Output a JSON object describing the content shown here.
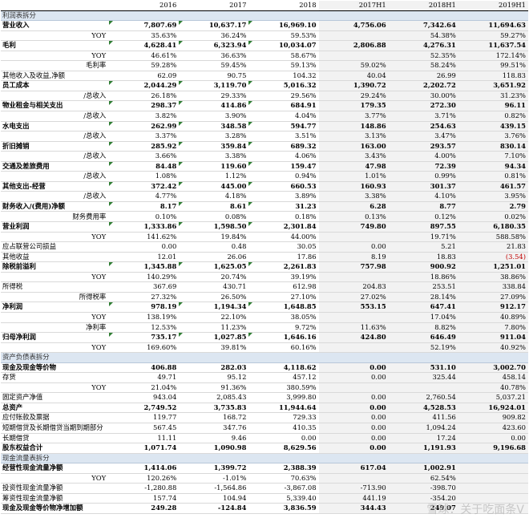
{
  "header": {
    "blank": "",
    "years": [
      "2016",
      "2017",
      "2018",
      "2017H1",
      "2018H1",
      "2019H1"
    ]
  },
  "sections": {
    "income": "利润表拆分",
    "balance": "资产负债表拆分",
    "cashflow": "现金流量表拆分"
  },
  "rows": {
    "r1": {
      "label": "营业收入",
      "v": [
        "7,807.69",
        "10,637.17",
        "16,969.10",
        "4,756.06",
        "7,342.64",
        "11,694.63"
      ]
    },
    "r2": {
      "label": "YOY",
      "v": [
        "35.63%",
        "36.24%",
        "59.53%",
        "",
        "54.38%",
        "59.27%"
      ]
    },
    "r3": {
      "label": "毛利",
      "v": [
        "4,628.41",
        "6,323.94",
        "10,034.07",
        "2,806.88",
        "4,276.31",
        "11,637.54"
      ]
    },
    "r4": {
      "label": "YOY",
      "v": [
        "46.61%",
        "36.63%",
        "58.67%",
        "",
        "52.35%",
        "172.14%"
      ]
    },
    "r5": {
      "label": "毛利率",
      "v": [
        "59.28%",
        "59.45%",
        "59.13%",
        "59.02%",
        "58.24%",
        "99.51%"
      ]
    },
    "r6": {
      "label": "其他收入及收益,净额",
      "v": [
        "62.09",
        "90.75",
        "104.32",
        "40.04",
        "26.99",
        "118.83"
      ]
    },
    "r7": {
      "label": "员工成本",
      "v": [
        "2,044.29",
        "3,119.70",
        "5,016.32",
        "1,390.72",
        "2,202.72",
        "3,651.92"
      ]
    },
    "r8": {
      "label": "/总收入",
      "v": [
        "26.18%",
        "29.33%",
        "29.56%",
        "29.24%",
        "30.00%",
        "31.23%"
      ]
    },
    "r9": {
      "label": "物业租金与相关支出",
      "v": [
        "298.37",
        "414.86",
        "684.91",
        "179.35",
        "272.30",
        "96.11"
      ]
    },
    "r10": {
      "label": "/总收入",
      "v": [
        "3.82%",
        "3.90%",
        "4.04%",
        "3.77%",
        "3.71%",
        "0.82%"
      ]
    },
    "r11": {
      "label": "水电支出",
      "v": [
        "262.99",
        "348.58",
        "594.77",
        "148.86",
        "254.63",
        "439.15"
      ]
    },
    "r12": {
      "label": "/总收入",
      "v": [
        "3.37%",
        "3.28%",
        "3.51%",
        "3.13%",
        "3.47%",
        "3.76%"
      ]
    },
    "r13": {
      "label": "折旧摊销",
      "v": [
        "285.92",
        "359.84",
        "689.32",
        "163.00",
        "293.57",
        "830.14"
      ]
    },
    "r14": {
      "label": "/总收入",
      "v": [
        "3.66%",
        "3.38%",
        "4.06%",
        "3.43%",
        "4.00%",
        "7.10%"
      ]
    },
    "r15": {
      "label": "交通及差旅费用",
      "v": [
        "84.48",
        "119.60",
        "159.47",
        "47.98",
        "72.39",
        "94.34"
      ]
    },
    "r16": {
      "label": "/总收入",
      "v": [
        "1.08%",
        "1.12%",
        "0.94%",
        "1.01%",
        "0.99%",
        "0.81%"
      ]
    },
    "r17": {
      "label": "其他支出-经营",
      "v": [
        "372.42",
        "445.00",
        "660.53",
        "160.93",
        "301.37",
        "461.57"
      ]
    },
    "r18": {
      "label": "/总收入",
      "v": [
        "4.77%",
        "4.18%",
        "3.89%",
        "3.38%",
        "4.10%",
        "3.95%"
      ]
    },
    "r19": {
      "label": "财务收入/(费用)净额",
      "v": [
        "8.17",
        "8.61",
        "31.23",
        "6.28",
        "8.77",
        "2.79"
      ]
    },
    "r20": {
      "label": "财务费用率",
      "v": [
        "0.10%",
        "0.08%",
        "0.18%",
        "0.13%",
        "0.12%",
        "0.02%"
      ]
    },
    "r21": {
      "label": "营业利润",
      "v": [
        "1,333.86",
        "1,598.50",
        "2,301.84",
        "749.80",
        "897.55",
        "6,180.35"
      ]
    },
    "r22": {
      "label": "YOY",
      "v": [
        "141.62%",
        "19.84%",
        "44.00%",
        "",
        "19.71%",
        "588.58%"
      ]
    },
    "r23": {
      "label": "应占联营公司损益",
      "v": [
        "0.00",
        "0.48",
        "30.05",
        "0.00",
        "5.21",
        "21.83"
      ]
    },
    "r24": {
      "label": "其他收益",
      "v": [
        "12.01",
        "26.06",
        "17.86",
        "8.19",
        "18.83",
        "(3.54)"
      ]
    },
    "r25": {
      "label": "除税前溢利",
      "v": [
        "1,345.88",
        "1,625.05",
        "2,261.83",
        "757.98",
        "900.92",
        "1,251.01"
      ]
    },
    "r26": {
      "label": "YOY",
      "v": [
        "140.29%",
        "20.74%",
        "39.19%",
        "",
        "18.86%",
        "38.86%"
      ]
    },
    "r27": {
      "label": "所得税",
      "v": [
        "367.69",
        "430.71",
        "612.98",
        "204.83",
        "253.51",
        "338.84"
      ]
    },
    "r28": {
      "label": "所得税率",
      "v": [
        "27.32%",
        "26.50%",
        "27.10%",
        "27.02%",
        "28.14%",
        "27.09%"
      ]
    },
    "r29": {
      "label": "净利润",
      "v": [
        "978.19",
        "1,194.34",
        "1,648.85",
        "553.15",
        "647.41",
        "912.17"
      ]
    },
    "r30": {
      "label": "YOY",
      "v": [
        "138.19%",
        "22.10%",
        "38.05%",
        "",
        "17.04%",
        "40.89%"
      ]
    },
    "r31": {
      "label": "净利率",
      "v": [
        "12.53%",
        "11.23%",
        "9.72%",
        "11.63%",
        "8.82%",
        "7.80%"
      ]
    },
    "r32": {
      "label": "归母净利润",
      "v": [
        "735.17",
        "1,027.85",
        "1,646.16",
        "424.80",
        "646.49",
        "911.04"
      ]
    },
    "r33": {
      "label": "YOY",
      "v": [
        "169.60%",
        "39.81%",
        "60.16%",
        "",
        "52.19%",
        "40.92%"
      ]
    },
    "b1": {
      "label": "现金及现金等价物",
      "v": [
        "406.88",
        "282.03",
        "4,118.62",
        "0.00",
        "531.10",
        "3,002.70"
      ]
    },
    "b2": {
      "label": "存货",
      "v": [
        "49.71",
        "95.12",
        "457.12",
        "0.00",
        "325.44",
        "458.14"
      ]
    },
    "b3": {
      "label": "YOY",
      "v": [
        "21.04%",
        "91.36%",
        "380.59%",
        "",
        "",
        "40.78%"
      ]
    },
    "b4": {
      "label": "固定资产净值",
      "v": [
        "943.04",
        "2,085.43",
        "3,999.80",
        "0.00",
        "2,760.54",
        "5,037.21"
      ]
    },
    "b5": {
      "label": "总资产",
      "v": [
        "2,749.52",
        "3,735.83",
        "11,944.64",
        "0.00",
        "4,528.53",
        "16,924.01"
      ]
    },
    "b6": {
      "label": "应付账款及票据",
      "v": [
        "119.77",
        "168.72",
        "729.33",
        "0.00",
        "411.56",
        "909.82"
      ]
    },
    "b7": {
      "label": "短期借贷及长期借贷当期到期部分",
      "v": [
        "567.45",
        "347.76",
        "410.35",
        "0.00",
        "1,094.24",
        "423.60"
      ]
    },
    "b8": {
      "label": "长期借贷",
      "v": [
        "11.11",
        "9.46",
        "0.00",
        "0.00",
        "17.24",
        "0.00"
      ]
    },
    "b9": {
      "label": "股东权益合计",
      "v": [
        "1,071.74",
        "1,090.98",
        "8,629.56",
        "0.00",
        "1,191.93",
        "9,196.68"
      ]
    },
    "c1": {
      "label": "经营性现金流量净额",
      "v": [
        "1,414.06",
        "1,399.72",
        "2,388.39",
        "617.04",
        "1,002.91",
        ""
      ]
    },
    "c2": {
      "label": "YOY",
      "v": [
        "120.26%",
        "-1.01%",
        "70.63%",
        "",
        "62.54%",
        ""
      ]
    },
    "c3": {
      "label": "投资性现金流量净额",
      "v": [
        "-1,280.88",
        "-1,564.86",
        "-3,867.08",
        "-713.90",
        "-398.70",
        ""
      ]
    },
    "c4": {
      "label": "筹资性现金流量净额",
      "v": [
        "157.74",
        "104.94",
        "5,339.40",
        "441.19",
        "-354.20",
        ""
      ]
    },
    "c5": {
      "label": "现金及现金等价物净增加额",
      "v": [
        "249.28",
        "-124.84",
        "3,836.59",
        "344.43",
        "249.07",
        ""
      ]
    }
  },
  "watermark": "雪球：关于吃面条V",
  "colors": {
    "section_bg": "#dce6f1",
    "shade": "#f2f2f2",
    "negative": "#c00000",
    "marker": "#2e7d32"
  }
}
